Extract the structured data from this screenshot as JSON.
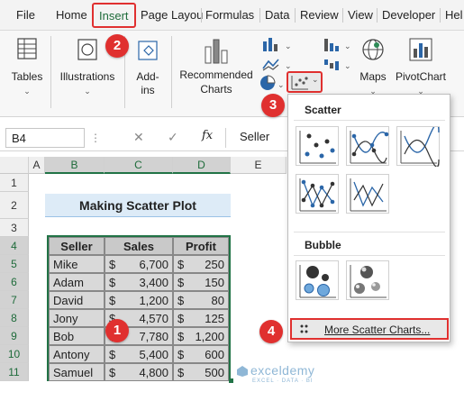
{
  "tabs": [
    "File",
    "Home",
    "Insert",
    "Page Layou",
    "Formulas",
    "Data",
    "Review",
    "View",
    "Developer",
    "Hel"
  ],
  "ribbon": {
    "tables": "Tables",
    "illustrations": "Illustrations",
    "addins_line1": "Add-",
    "addins_line2": "ins",
    "recommended_line1": "Recommended",
    "recommended_line2": "Charts",
    "maps": "Maps",
    "pivotchart": "PivotChart"
  },
  "formula_bar": {
    "name_box": "B4",
    "fx": "fx",
    "content": "Seller"
  },
  "grid": {
    "columns": [
      "A",
      "B",
      "C",
      "D",
      "E"
    ],
    "rows": [
      "1",
      "2",
      "3",
      "4",
      "5",
      "6",
      "7",
      "8",
      "9",
      "10",
      "11"
    ],
    "title": "Making Scatter Plot",
    "headers": [
      "Seller",
      "Sales",
      "Profit"
    ],
    "currency": "$",
    "data": [
      {
        "seller": "Mike",
        "sales": "6,700",
        "profit": "250"
      },
      {
        "seller": "Adam",
        "sales": "3,400",
        "profit": "150"
      },
      {
        "seller": "David",
        "sales": "1,200",
        "profit": "80"
      },
      {
        "seller": "Jony",
        "sales": "4,570",
        "profit": "125"
      },
      {
        "seller": "Bob",
        "sales": "7,780",
        "profit": "1,200"
      },
      {
        "seller": "Antony",
        "sales": "5,400",
        "profit": "600"
      },
      {
        "seller": "Samuel",
        "sales": "4,800",
        "profit": "500"
      }
    ]
  },
  "dropdown": {
    "scatter_title": "Scatter",
    "bubble_title": "Bubble",
    "more_label": "More Scatter Charts..."
  },
  "badges": [
    "1",
    "2",
    "3",
    "4"
  ],
  "watermark": {
    "name": "exceldemy",
    "tagline": "EXCEL · DATA · BI"
  },
  "colors": {
    "accent_green": "#1e6b3a",
    "badge_red": "#e0302f",
    "title_fill": "#ddebf7",
    "header_fill": "#c9c9c9",
    "data_fill": "#d9d9d9",
    "selection": "#217346"
  }
}
